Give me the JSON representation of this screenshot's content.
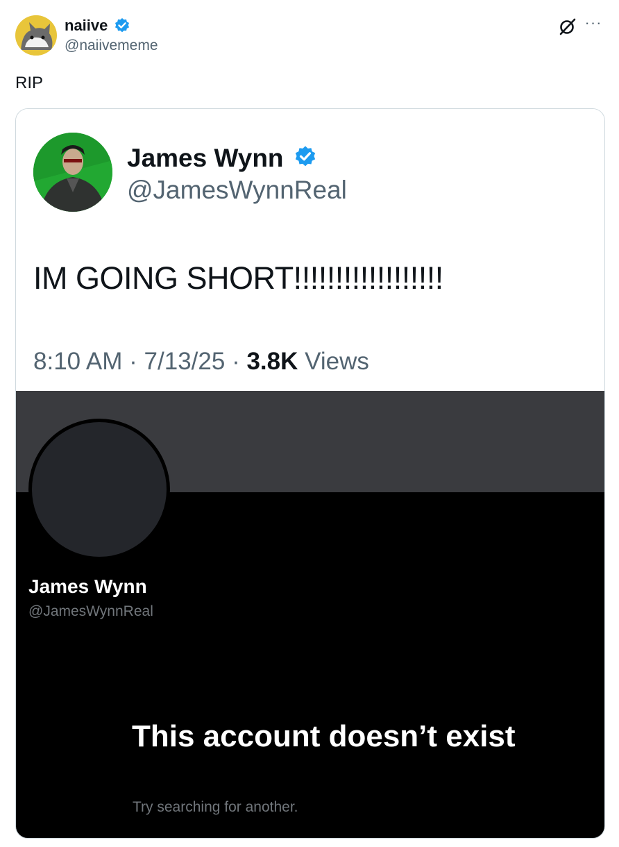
{
  "post": {
    "author_name": "naiive",
    "author_handle": "@naiivememe",
    "text": "RIP"
  },
  "quoted": {
    "name": "James Wynn",
    "handle": "@JamesWynnReal",
    "text": "IM GOING SHORT!!!!!!!!!!!!!!!!!!",
    "time": "8:10 AM",
    "date": "7/13/25",
    "views_count": "3.8K",
    "views_label": "Views"
  },
  "profile": {
    "name": "James Wynn",
    "handle": "@JamesWynnReal",
    "empty_title": "This account doesn’t exist",
    "empty_subtitle": "Try searching for another."
  },
  "colors": {
    "verified": "#1d9bf0",
    "banner": "#3a3b3f",
    "dark_bg": "#000000"
  },
  "icons": [
    "verified-badge-icon",
    "grok-icon",
    "more-icon"
  ]
}
